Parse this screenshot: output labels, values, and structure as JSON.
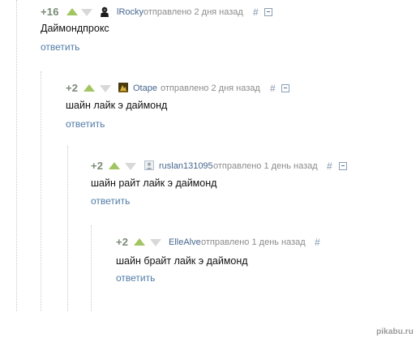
{
  "comments": [
    {
      "rating": "+16",
      "username": "lRocky",
      "avatar_icon": "hoodie-figure-icon",
      "meta": "отправлено 2 дня назад",
      "anchor": "#",
      "text": "Даймондпрокс",
      "reply": "ответить"
    },
    {
      "rating": "+2",
      "username": "Otape",
      "avatar_icon": "small-picture-avatar-icon",
      "meta": "отправлено 2 дня назад",
      "anchor": "#",
      "text": "шайн лайк э даймонд",
      "reply": "ответить"
    },
    {
      "rating": "+2",
      "username": "ruslan131095",
      "avatar_icon": "default-avatar-icon",
      "meta": "отправлено 1 день назад",
      "anchor": "#",
      "text": "шайн райт лайк э даймонд",
      "reply": "ответить"
    },
    {
      "rating": "+2",
      "username": "ElleAlve",
      "meta": "отправлено 1 день назад",
      "anchor": "#",
      "text": "шайн брайт лайк э даймонд",
      "reply": "ответить"
    }
  ],
  "watermark": "pikabu.ru",
  "colors": {
    "vote_up": "#a2c561",
    "vote_down": "#d8d8d8",
    "link": "#4f7aa6",
    "rating": "#7a8a76",
    "meta": "#8c8c8c"
  }
}
